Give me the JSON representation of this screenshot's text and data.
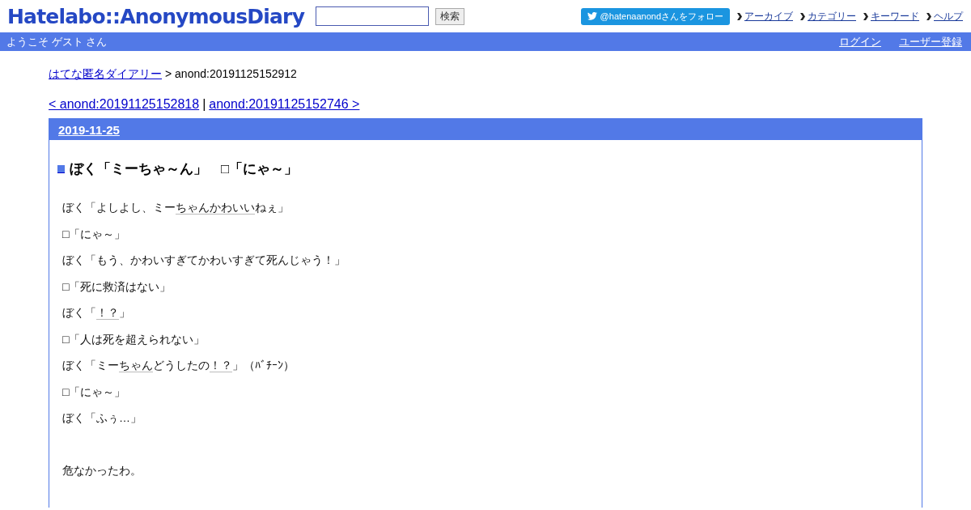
{
  "header": {
    "logo": "Hatelabo::AnonymousDiary",
    "search": {
      "button": "検索"
    },
    "follow_button": "@hatenaanondさんをフォロー",
    "nav": [
      "アーカイブ",
      "カテゴリー",
      "キーワード",
      "ヘルプ"
    ]
  },
  "user_bar": {
    "welcome": "ようこそ ゲスト さん",
    "links": [
      "ログイン",
      "ユーザー登録"
    ]
  },
  "breadcrumb": {
    "link": "はてな匿名ダイアリー",
    "current": "> anond:20191125152912"
  },
  "pager": {
    "prev": "< anond:20191125152818",
    "separator": "|",
    "next": "anond:20191125152746 >"
  },
  "day": {
    "date": "2019-11-25",
    "title": "ぼく「ミーちゃ～ん」　□「にゃ～」",
    "paragraphs": [
      [
        {
          "text": "ぼく「よしよし、ミー",
          "keyword": false
        },
        {
          "text": "ちゃんかわいい",
          "keyword": true
        },
        {
          "text": "ねぇ」",
          "keyword": false
        }
      ],
      [
        {
          "text": "□「にゃ～」",
          "keyword": false
        }
      ],
      [
        {
          "text": "ぼく「もう、かわいすぎてかわいすぎて死んじゃう！」",
          "keyword": false
        }
      ],
      [
        {
          "text": "□「死に救済はない」",
          "keyword": false
        }
      ],
      [
        {
          "text": "ぼく「",
          "keyword": false
        },
        {
          "text": "！？",
          "keyword": true
        },
        {
          "text": "」",
          "keyword": false
        }
      ],
      [
        {
          "text": "□「人は死を超えられない」",
          "keyword": false
        }
      ],
      [
        {
          "text": "ぼく「ミー",
          "keyword": false
        },
        {
          "text": "ちゃん",
          "keyword": true
        },
        {
          "text": "どうしたの",
          "keyword": false
        },
        {
          "text": "！？",
          "keyword": true
        },
        {
          "text": "」（ﾊﾞﾁｰﾝ）",
          "keyword": false
        }
      ],
      [
        {
          "text": "□「にゃ～」",
          "keyword": false
        }
      ],
      [
        {
          "text": "ぼく「ふぅ…」",
          "keyword": false
        }
      ]
    ],
    "closing": "危なかったわ。"
  }
}
